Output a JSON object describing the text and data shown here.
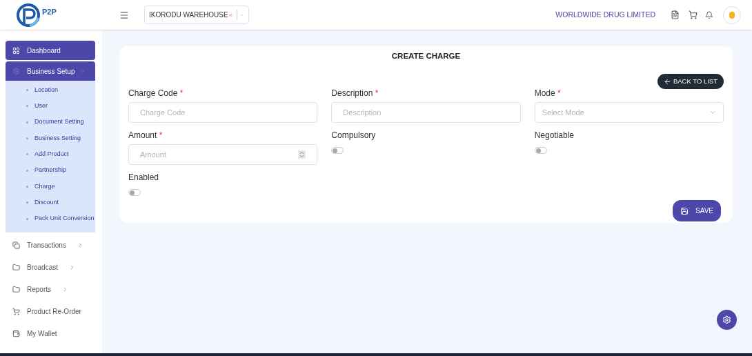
{
  "header": {
    "logo_text": "P2P",
    "warehouse": "IKORODU WAREHOUSE",
    "company": "WORLDWIDE DRUG LIMITED"
  },
  "sidebar": {
    "items": [
      {
        "label": "Dashboard",
        "selected": true,
        "expanded": false,
        "has_arrow": false
      },
      {
        "label": "Business Setup",
        "selected": true,
        "expanded": true,
        "has_arrow": true,
        "children": [
          {
            "label": "Location"
          },
          {
            "label": "User"
          },
          {
            "label": "Document Setting"
          },
          {
            "label": "Business Setting"
          },
          {
            "label": "Add Product"
          },
          {
            "label": "Partnership"
          },
          {
            "label": "Charge"
          },
          {
            "label": "Discount"
          },
          {
            "label": "Pack Unit Conversion"
          }
        ]
      },
      {
        "label": "Transactions",
        "selected": false,
        "expanded": false,
        "has_arrow": true
      },
      {
        "label": "Broadcast",
        "selected": false,
        "expanded": false,
        "has_arrow": true
      },
      {
        "label": "Reports",
        "selected": false,
        "expanded": false,
        "has_arrow": true
      },
      {
        "label": "Product Re-Order",
        "selected": false,
        "expanded": false,
        "has_arrow": false
      },
      {
        "label": "My Wallet",
        "selected": false,
        "expanded": false,
        "has_arrow": false
      }
    ]
  },
  "form": {
    "title": "CREATE CHARGE",
    "back_button": "BACK TO LIST",
    "save_button": "SAVE",
    "fields": [
      {
        "kind": "text",
        "label": "Charge Code",
        "required_mark": "*",
        "placeholder": "Charge Code"
      },
      {
        "kind": "text",
        "label": "Description",
        "required_mark": "*",
        "placeholder": "Description"
      },
      {
        "kind": "select",
        "label": "Mode",
        "required_mark": "*",
        "placeholder": "Select Mode"
      },
      {
        "kind": "number",
        "label": "Amount",
        "required_mark": "*",
        "placeholder": "Amount"
      },
      {
        "kind": "toggle",
        "label": "Compulsory",
        "on": false
      },
      {
        "kind": "toggle",
        "label": "Negotiable",
        "on": false
      },
      {
        "kind": "toggle",
        "label": "Enabled",
        "on": false
      }
    ]
  }
}
